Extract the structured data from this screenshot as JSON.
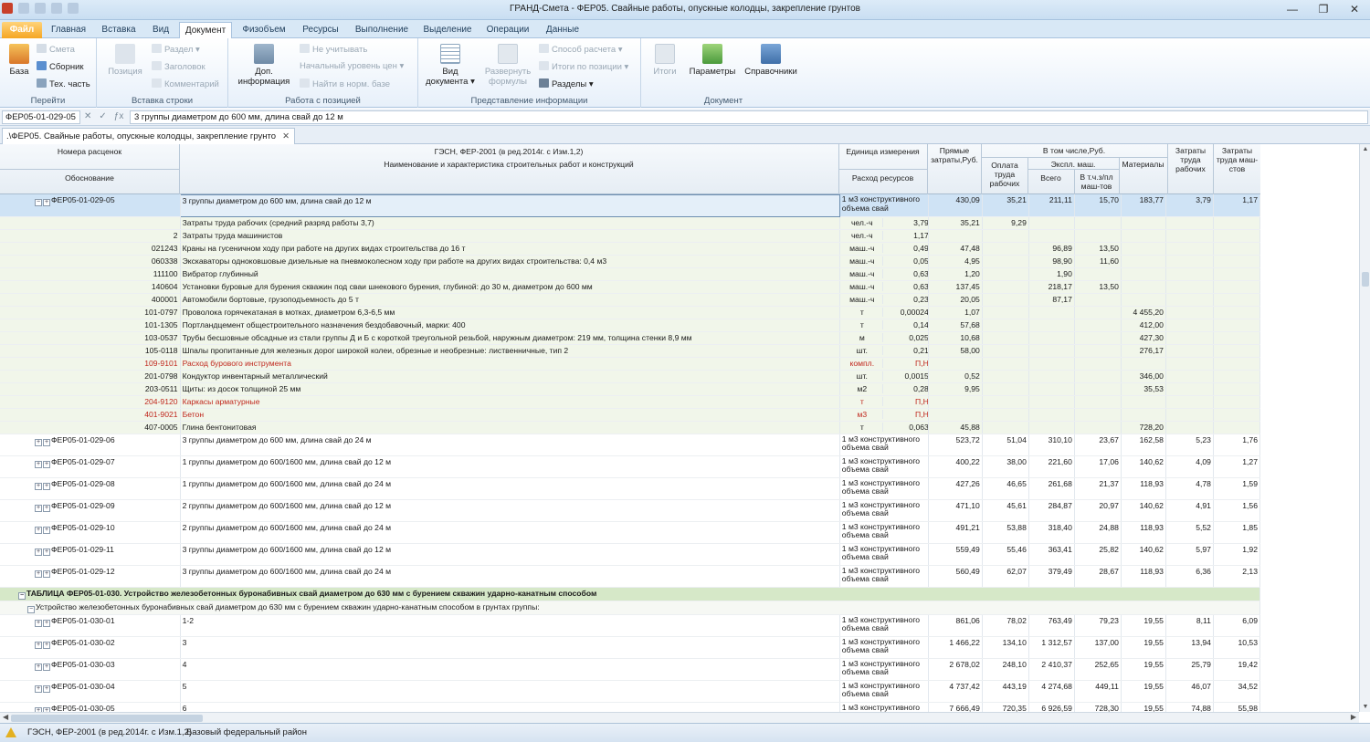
{
  "window": {
    "title": "ГРАНД-Смета - ФЕР05. Свайные работы, опускные колодцы, закрепление грунтов",
    "controls": [
      "—",
      "❐",
      "✕"
    ]
  },
  "ribbon_tabs": [
    "Файл",
    "Главная",
    "Вставка",
    "Вид",
    "Документ",
    "Физобъем",
    "Ресурсы",
    "Выполнение",
    "Выделение",
    "Операции",
    "Данные"
  ],
  "ribbon": {
    "goto": {
      "label": "Перейти",
      "base": "База",
      "smeta": "Смета",
      "sbornik": "Сборник",
      "tech": "Тех. часть"
    },
    "insert": {
      "label": "Вставка строки",
      "position": "Позиция",
      "razdel": "Раздел",
      "zagolovok": "Заголовок",
      "comment": "Комментарий"
    },
    "position": {
      "label": "Работа с позицией",
      "dop_info": "Доп. информация",
      "ne_uchit": "Не учитывать",
      "nach_uroven": "Начальный уровень цен",
      "find_norm": "Найти в норм. базе"
    },
    "present": {
      "label": "Представление информации",
      "vid_doc": "Вид документа",
      "razvern": "Развернуть формулы",
      "sposob": "Способ расчета",
      "itogi_poz": "Итоги по позиции",
      "razdely": "Разделы"
    },
    "document": {
      "label": "Документ",
      "itogi": "Итоги",
      "parametry": "Параметры",
      "spravochniki": "Справочники"
    }
  },
  "formula_bar": {
    "cell": "ФЕР05-01-029-05",
    "text": "3 группы диаметром до 600 мм, длина свай до 12 м"
  },
  "doc_tab": {
    "label": ".\\ФЕР05. Свайные работы, опускные колодцы, закрепление грунто"
  },
  "header": {
    "nomera": "Номера расценок",
    "obosn": "Обоснование",
    "gesn": "ГЭСН, ФЕР-2001 (в ред.2014г. с Изм.1,2)",
    "naim": "Наименование и характеристика строительных работ и конструкций",
    "ed_izm": "Единица измерения",
    "rashod": "Расход ресурсов",
    "pryamye": "Прямые затраты,Руб.",
    "v_tom": "В том числе,Руб.",
    "oplata": "Оплата труда рабочих",
    "ekspl": "Экспл. маш.",
    "vsego": "Всего",
    "vtch": "В т.ч.з/пл маш-тов",
    "materialy": "Материалы",
    "zatr_rab": "Затраты труда рабочих",
    "zatr_mash": "Затраты труда маш-стов"
  },
  "rows": [
    {
      "type": "sel",
      "code": "ФЕР05-01-029-05",
      "desc": "3 группы диаметром до 600 мм, длина свай до 12 м",
      "unit": "1 м3 конструктивного объема свай",
      "qty": "",
      "pryam": "430,09",
      "opl": "35,21",
      "eks": "211,11",
      "vtch": "15,70",
      "mat": "183,77",
      "zr": "3,79",
      "zm": "1,17"
    },
    {
      "type": "sub",
      "code": "",
      "desc": "Затраты труда рабочих (средний разряд работы 3,7)",
      "unit": "чел.-ч",
      "qty": "3,79",
      "pryam": "35,21",
      "opl": "9,29",
      "eks": "",
      "vtch": "",
      "mat": "",
      "zr": "",
      "zm": ""
    },
    {
      "type": "sub",
      "code": "2",
      "desc": "Затраты труда машинистов",
      "unit": "чел.-ч",
      "qty": "1,17",
      "pryam": "",
      "opl": "",
      "eks": "",
      "vtch": "",
      "mat": "",
      "zr": "",
      "zm": ""
    },
    {
      "type": "sub",
      "code": "021243",
      "desc": "Краны на гусеничном ходу при работе на других видах строительства до 16 т",
      "unit": "маш.-ч",
      "qty": "0,49",
      "pryam": "47,48",
      "opl": "",
      "eks": "96,89",
      "vtch": "13,50",
      "mat": "",
      "zr": "",
      "zm": ""
    },
    {
      "type": "sub",
      "code": "060338",
      "desc": "Экскаваторы одноковшовые дизельные на пневмоколесном ходу при работе на других видах строительства: 0,4 м3",
      "unit": "маш.-ч",
      "qty": "0,05",
      "pryam": "4,95",
      "opl": "",
      "eks": "98,90",
      "vtch": "11,60",
      "mat": "",
      "zr": "",
      "zm": ""
    },
    {
      "type": "sub",
      "code": "111100",
      "desc": "Вибратор глубинный",
      "unit": "маш.-ч",
      "qty": "0,63",
      "pryam": "1,20",
      "opl": "",
      "eks": "1,90",
      "vtch": "",
      "mat": "",
      "zr": "",
      "zm": ""
    },
    {
      "type": "sub",
      "code": "140604",
      "desc": "Установки буровые для бурения скважин под сваи шнекового бурения, глубиной: до 30 м, диаметром до 600 мм",
      "unit": "маш.-ч",
      "qty": "0,63",
      "pryam": "137,45",
      "opl": "",
      "eks": "218,17",
      "vtch": "13,50",
      "mat": "",
      "zr": "",
      "zm": ""
    },
    {
      "type": "sub",
      "code": "400001",
      "desc": "Автомобили бортовые, грузоподъемность до 5 т",
      "unit": "маш.-ч",
      "qty": "0,23",
      "pryam": "20,05",
      "opl": "",
      "eks": "87,17",
      "vtch": "",
      "mat": "",
      "zr": "",
      "zm": ""
    },
    {
      "type": "sub",
      "code": "101-0797",
      "desc": "Проволока горячекатаная в мотках, диаметром 6,3-6,5 мм",
      "unit": "т",
      "qty": "0,00024",
      "pryam": "1,07",
      "opl": "",
      "eks": "",
      "vtch": "",
      "mat": "4 455,20",
      "zr": "",
      "zm": ""
    },
    {
      "type": "sub",
      "code": "101-1305",
      "desc": "Портландцемент общестроительного назначения бездобавочный, марки: 400",
      "unit": "т",
      "qty": "0,14",
      "pryam": "57,68",
      "opl": "",
      "eks": "",
      "vtch": "",
      "mat": "412,00",
      "zr": "",
      "zm": ""
    },
    {
      "type": "sub",
      "code": "103-0537",
      "desc": "Трубы бесшовные обсадные из стали группы Д и Б с короткой треугольной резьбой, наружным диаметром: 219 мм, толщина стенки 8,9 мм",
      "unit": "м",
      "qty": "0,025",
      "pryam": "10,68",
      "opl": "",
      "eks": "",
      "vtch": "",
      "mat": "427,30",
      "zr": "",
      "zm": ""
    },
    {
      "type": "sub",
      "code": "105-0118",
      "desc": "Шпалы пропитанные для железных дорог широкой колеи, обрезные и необрезные: лиственничные, тип 2",
      "unit": "шт.",
      "qty": "0,21",
      "pryam": "58,00",
      "opl": "",
      "eks": "",
      "vtch": "",
      "mat": "276,17",
      "zr": "",
      "zm": ""
    },
    {
      "type": "sub red",
      "code": "109-9101",
      "desc": "Расход бурового инструмента",
      "unit": "компл.",
      "qty": "П,Н",
      "pryam": "",
      "opl": "",
      "eks": "",
      "vtch": "",
      "mat": "",
      "zr": "",
      "zm": ""
    },
    {
      "type": "sub",
      "code": "201-0798",
      "desc": "Кондуктор инвентарный металлический",
      "unit": "шт.",
      "qty": "0,0015",
      "pryam": "0,52",
      "opl": "",
      "eks": "",
      "vtch": "",
      "mat": "346,00",
      "zr": "",
      "zm": ""
    },
    {
      "type": "sub",
      "code": "203-0511",
      "desc": "Щиты: из досок толщиной 25 мм",
      "unit": "м2",
      "qty": "0,28",
      "pryam": "9,95",
      "opl": "",
      "eks": "",
      "vtch": "",
      "mat": "35,53",
      "zr": "",
      "zm": ""
    },
    {
      "type": "sub red",
      "code": "204-9120",
      "desc": "Каркасы арматурные",
      "unit": "т",
      "qty": "П,Н",
      "pryam": "",
      "opl": "",
      "eks": "",
      "vtch": "",
      "mat": "",
      "zr": "",
      "zm": ""
    },
    {
      "type": "sub red",
      "code": "401-9021",
      "desc": "Бетон",
      "unit": "м3",
      "qty": "П,Н",
      "pryam": "",
      "opl": "",
      "eks": "",
      "vtch": "",
      "mat": "",
      "zr": "",
      "zm": ""
    },
    {
      "type": "sub",
      "code": "407-0005",
      "desc": "Глина бентонитовая",
      "unit": "т",
      "qty": "0,063",
      "pryam": "45,88",
      "opl": "",
      "eks": "",
      "vtch": "",
      "mat": "728,20",
      "zr": "",
      "zm": ""
    },
    {
      "type": "main",
      "code": "ФЕР05-01-029-06",
      "desc": "3 группы диаметром до 600 мм, длина свай до 24 м",
      "unit": "1 м3 конструктивного объема свай",
      "qty": "",
      "pryam": "523,72",
      "opl": "51,04",
      "eks": "310,10",
      "vtch": "23,67",
      "mat": "162,58",
      "zr": "5,23",
      "zm": "1,76"
    },
    {
      "type": "main",
      "code": "ФЕР05-01-029-07",
      "desc": "1 группы диаметром до 600/1600 мм, длина свай до 12 м",
      "unit": "1 м3 конструктивного объема свай",
      "qty": "",
      "pryam": "400,22",
      "opl": "38,00",
      "eks": "221,60",
      "vtch": "17,06",
      "mat": "140,62",
      "zr": "4,09",
      "zm": "1,27"
    },
    {
      "type": "main",
      "code": "ФЕР05-01-029-08",
      "desc": "1 группы диаметром до 600/1600 мм, длина свай до 24 м",
      "unit": "1 м3 конструктивного объема свай",
      "qty": "",
      "pryam": "427,26",
      "opl": "46,65",
      "eks": "261,68",
      "vtch": "21,37",
      "mat": "118,93",
      "zr": "4,78",
      "zm": "1,59"
    },
    {
      "type": "main",
      "code": "ФЕР05-01-029-09",
      "desc": "2 группы диаметром до 600/1600 мм, длина свай до 12 м",
      "unit": "1 м3 конструктивного объема свай",
      "qty": "",
      "pryam": "471,10",
      "opl": "45,61",
      "eks": "284,87",
      "vtch": "20,97",
      "mat": "140,62",
      "zr": "4,91",
      "zm": "1,56"
    },
    {
      "type": "main",
      "code": "ФЕР05-01-029-10",
      "desc": "2 группы диаметром до 600/1600 мм, длина свай до 24 м",
      "unit": "1 м3 конструктивного объема свай",
      "qty": "",
      "pryam": "491,21",
      "opl": "53,88",
      "eks": "318,40",
      "vtch": "24,88",
      "mat": "118,93",
      "zr": "5,52",
      "zm": "1,85"
    },
    {
      "type": "main",
      "code": "ФЕР05-01-029-11",
      "desc": "3 группы диаметром до 600/1600 мм, длина свай до 12 м",
      "unit": "1 м3 конструктивного объема свай",
      "qty": "",
      "pryam": "559,49",
      "opl": "55,46",
      "eks": "363,41",
      "vtch": "25,82",
      "mat": "140,62",
      "zr": "5,97",
      "zm": "1,92"
    },
    {
      "type": "main",
      "code": "ФЕР05-01-029-12",
      "desc": "3 группы диаметром до 600/1600 мм, длина свай до 24 м",
      "unit": "1 м3 конструктивного объема свай",
      "qty": "",
      "pryam": "560,49",
      "opl": "62,07",
      "eks": "379,49",
      "vtch": "28,67",
      "mat": "118,93",
      "zr": "6,36",
      "zm": "2,13"
    },
    {
      "type": "sect",
      "code": "ТАБЛИЦА ФЕР05-01-030. Устройство железобетонных буронабивных свай диаметром до 630 мм с бурением скважин ударно-канатным способом"
    },
    {
      "type": "subsect",
      "code": "Устройство железобетонных буронабивных свай диаметром до 630 мм с бурением скважин ударно-канатным способом в грунтах группы:"
    },
    {
      "type": "main",
      "code": "ФЕР05-01-030-01",
      "desc": "1-2",
      "unit": "1 м3 конструктивного объема свай",
      "qty": "",
      "pryam": "861,06",
      "opl": "78,02",
      "eks": "763,49",
      "vtch": "79,23",
      "mat": "19,55",
      "zr": "8,11",
      "zm": "6,09"
    },
    {
      "type": "main",
      "code": "ФЕР05-01-030-02",
      "desc": "3",
      "unit": "1 м3 конструктивного объема свай",
      "qty": "",
      "pryam": "1 466,22",
      "opl": "134,10",
      "eks": "1 312,57",
      "vtch": "137,00",
      "mat": "19,55",
      "zr": "13,94",
      "zm": "10,53"
    },
    {
      "type": "main",
      "code": "ФЕР05-01-030-03",
      "desc": "4",
      "unit": "1 м3 конструктивного объема свай",
      "qty": "",
      "pryam": "2 678,02",
      "opl": "248,10",
      "eks": "2 410,37",
      "vtch": "252,65",
      "mat": "19,55",
      "zr": "25,79",
      "zm": "19,42"
    },
    {
      "type": "main",
      "code": "ФЕР05-01-030-04",
      "desc": "5",
      "unit": "1 м3 конструктивного объема свай",
      "qty": "",
      "pryam": "4 737,42",
      "opl": "443,19",
      "eks": "4 274,68",
      "vtch": "449,11",
      "mat": "19,55",
      "zr": "46,07",
      "zm": "34,52"
    },
    {
      "type": "main",
      "code": "ФЕР05-01-030-05",
      "desc": "6",
      "unit": "1 м3 конструктивного",
      "qty": "",
      "pryam": "7 666,49",
      "opl": "720,35",
      "eks": "6 926,59",
      "vtch": "728,30",
      "mat": "19,55",
      "zr": "74,88",
      "zm": "55,98"
    }
  ],
  "status": {
    "norm_base": "ГЭСН, ФЕР-2001 (в ред.2014г. с Изм.1,2)",
    "region": "Базовый федеральный район"
  }
}
